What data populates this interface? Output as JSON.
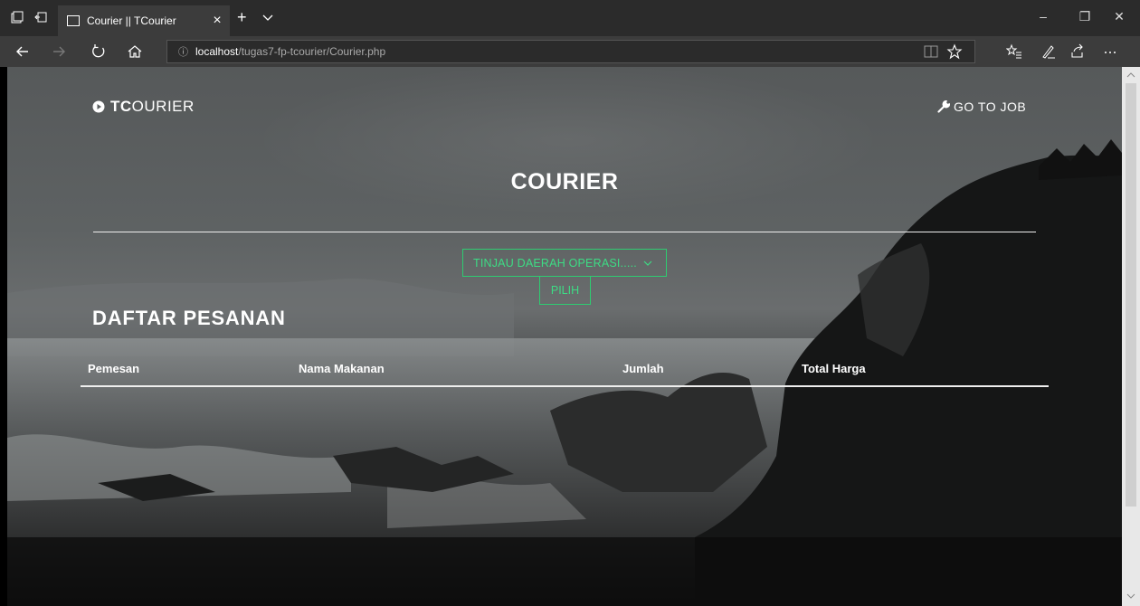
{
  "browser": {
    "tab_title": "Courier || TCourier",
    "tab_close": "×",
    "new_tab": "+",
    "address_info": "ⓘ",
    "address_host": "localhost",
    "address_path": "/tugas7-fp-tcourier/Courier.php",
    "window_controls": {
      "minimize": "–",
      "restore": "❐",
      "close": "✕"
    }
  },
  "header": {
    "brand_bold": "TC",
    "brand_rest": "OURIER",
    "goto_job": "GO TO JOB"
  },
  "main": {
    "title": "COURIER",
    "select": {
      "value": "TINJAU DAERAH OPERASI....."
    },
    "pilih_button": "PILIH",
    "section_title": "DAFTAR PESANAN",
    "table": {
      "headers": [
        "Pemesan",
        "Nama Makanan",
        "Jumlah",
        "Total Harga"
      ],
      "rows": []
    }
  },
  "colors": {
    "accent": "#2ecc71",
    "chrome_dark": "#2b2b2b",
    "chrome_mid": "#3c3c3c"
  }
}
